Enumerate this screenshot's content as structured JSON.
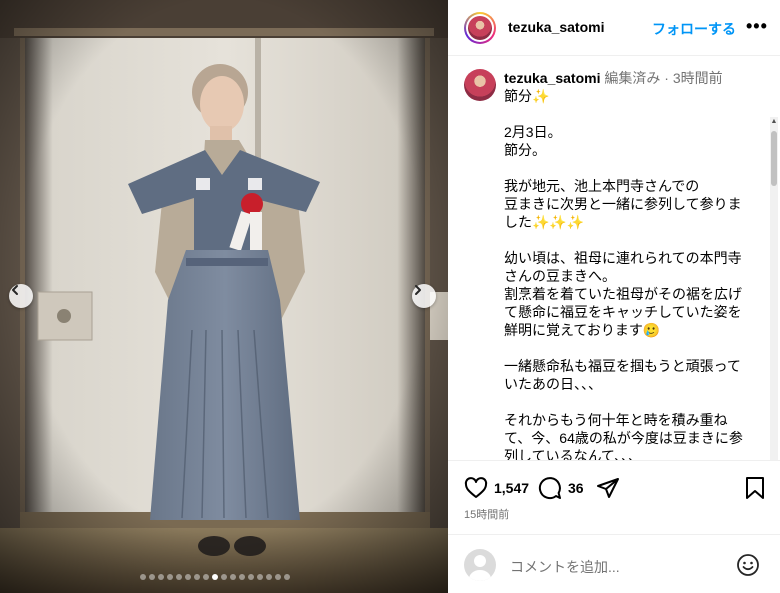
{
  "post": {
    "username": "tezuka_satomi",
    "follow_label": "フォローする",
    "more_label": "•••"
  },
  "caption": {
    "username": "tezuka_satomi",
    "edited": "編集済み",
    "separator": "·",
    "time_ago": "3時間前",
    "lines": [
      "節分✨",
      "",
      "2月3日。",
      "節分。",
      "",
      "我が地元、池上本門寺さんでの",
      "豆まきに次男と一緒に参列して参りま",
      "した✨✨✨",
      "",
      "幼い頃は、祖母に連れられての本門寺",
      "さんの豆まきへ。",
      "割烹着を着ていた祖母がその裾を広げ",
      "て懸命に福豆をキャッチしていた姿を",
      "鮮明に覚えております🥲",
      "",
      "一緒懸命私も福豆を掴もうと頑張って",
      "いたあの日、、、",
      "",
      "それからもう何十年と時を積み重ね",
      "て、今、64歳の私が今度は豆まきに参",
      "列しているなんて、、、"
    ]
  },
  "actions": {
    "likes": "1,547",
    "comments": "36",
    "icons": [
      "heart-icon",
      "comment-icon",
      "share-icon",
      "bookmark-icon"
    ]
  },
  "timestamp": "15時間前",
  "comment_box": {
    "placeholder": "コメントを追加..."
  },
  "carousel": {
    "total": 17,
    "active_index": 8
  },
  "colors": {
    "follow": "#0095f6",
    "meta": "#737373"
  }
}
